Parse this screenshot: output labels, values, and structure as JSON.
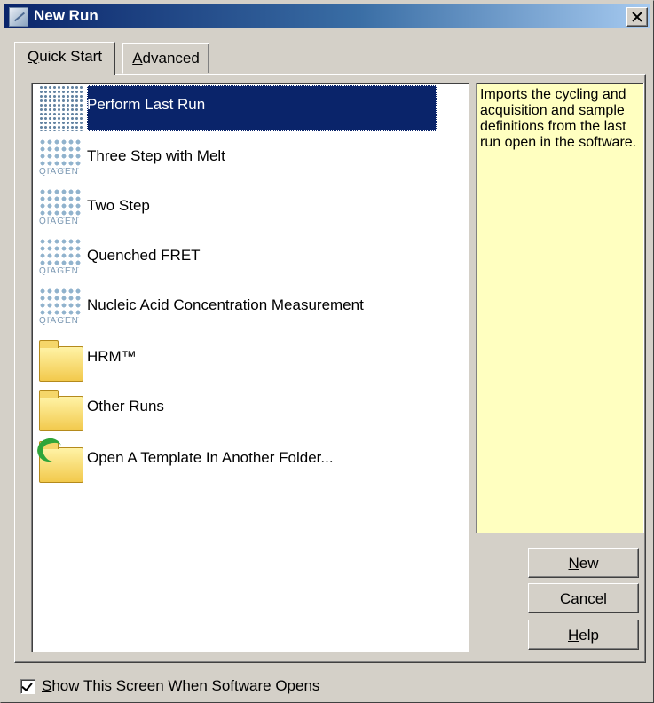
{
  "window": {
    "title": "New Run"
  },
  "tabs": [
    {
      "accel": "Q",
      "rest": "uick Start",
      "active": true
    },
    {
      "accel": "A",
      "rest": "dvanced",
      "active": false
    }
  ],
  "list": {
    "items": [
      {
        "label": "Perform Last Run",
        "icon": "qiagen-template-icon",
        "selected": true
      },
      {
        "label": "Three Step with Melt",
        "icon": "qiagen-template-icon"
      },
      {
        "label": "Two Step",
        "icon": "qiagen-template-icon"
      },
      {
        "label": "Quenched FRET",
        "icon": "qiagen-template-icon"
      },
      {
        "label": "Nucleic Acid Concentration Measurement",
        "icon": "qiagen-template-icon"
      },
      {
        "label": "HRM™",
        "icon": "folder-icon"
      },
      {
        "label": "Other Runs",
        "icon": "folder-icon"
      },
      {
        "label": "Open A Template In Another Folder...",
        "icon": "open-folder-icon"
      }
    ],
    "brand_text": "QIAGEN"
  },
  "description": "Imports the cycling and acquisition and sample definitions from the last run open in the software.",
  "buttons": {
    "new": {
      "accel": "N",
      "rest": "ew"
    },
    "cancel": {
      "label": "Cancel"
    },
    "help": {
      "accel": "H",
      "rest": "elp"
    }
  },
  "show_screen_checkbox": {
    "checked": true,
    "accel": "S",
    "rest": "how This Screen When Software Opens"
  },
  "colors": {
    "selection": "#0a246a",
    "description_bg": "#ffffc0",
    "dialog_bg": "#d4d0c8"
  }
}
